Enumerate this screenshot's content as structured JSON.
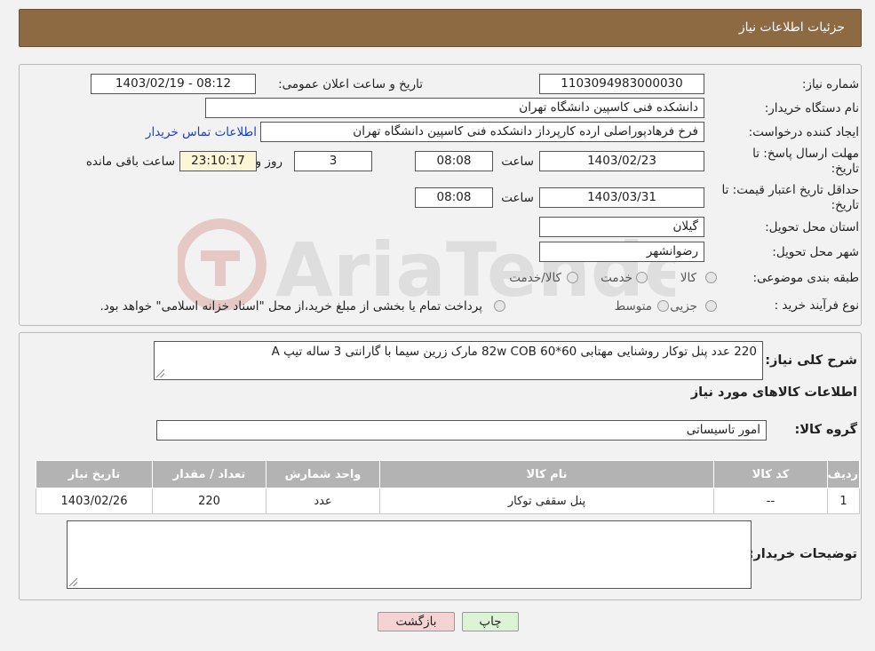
{
  "header": {
    "title": "جزئیات اطلاعات نیاز"
  },
  "form": {
    "need_number_label": "شماره نیاز:",
    "need_number": "1103094983000030",
    "announce_label": "تاریخ و ساعت اعلان عمومی:",
    "announce_value": "1403/02/19 - 08:12",
    "buyer_org_label": "نام دستگاه خریدار:",
    "buyer_org": "دانشکده فنی کاسپین دانشگاه تهران",
    "creator_label": "ایجاد کننده درخواست:",
    "creator": "فرخ فرهادپوراصلی ارده کارپرداز دانشکده فنی کاسپین دانشگاه تهران",
    "contact_link": "اطلاعات تماس خریدار",
    "deadline_label_1": "مهلت ارسال پاسخ: تا",
    "deadline_label_2": "تاریخ:",
    "deadline_date": "1403/02/23",
    "time_label": "ساعت",
    "deadline_time": "08:08",
    "days": "3",
    "days_label": "روز و",
    "remaining_time": "23:10:17",
    "remaining_label": "ساعت باقی مانده",
    "validity_label_1": "حداقل تاریخ اعتبار قیمت: تا",
    "validity_label_2": "تاریخ:",
    "validity_date": "1403/03/31",
    "validity_time": "08:08",
    "province_label": "استان محل تحویل:",
    "province": "گیلان",
    "city_label": "شهر محل تحویل:",
    "city": "رضوانشهر",
    "category_label": "طبقه بندی موضوعی:",
    "category_options": [
      "کالا",
      "خدمت",
      "کالا/خدمت"
    ],
    "process_label": "نوع فرآیند خرید :",
    "process_options": [
      "جزیی",
      "متوسط"
    ],
    "payment_note": "پرداخت تمام یا بخشی از مبلغ خرید،از محل \"اسناد خزانه اسلامی\" خواهد بود."
  },
  "details": {
    "summary_label": "شرح کلی نیاز:",
    "summary": "220 عدد پنل توکار روشنایی مهتابی 60*60 82w COB مارک زرین سیما با گارانتی 3 ساله تیپ A",
    "items_title": "اطلاعات کالاهای مورد نیاز",
    "group_label": "گروه کالا:",
    "group": "امور تاسیساتی",
    "table": {
      "headers": [
        "ردیف",
        "کد کالا",
        "نام کالا",
        "واحد شمارش",
        "تعداد / مقدار",
        "تاریخ نیاز"
      ],
      "rows": [
        [
          "1",
          "--",
          "پنل سقفی توکار",
          "عدد",
          "220",
          "1403/02/26"
        ]
      ]
    },
    "buyer_notes_label": "توضیحات خریدار:",
    "buyer_notes": ""
  },
  "buttons": {
    "print": "چاپ",
    "back": "بازگشت"
  },
  "colors": {
    "header_bg": "#8e6a42",
    "link": "#1e3fbf",
    "back_btn_bg": "#f6d3d3",
    "print_btn_bg": "#ddf3d6"
  }
}
